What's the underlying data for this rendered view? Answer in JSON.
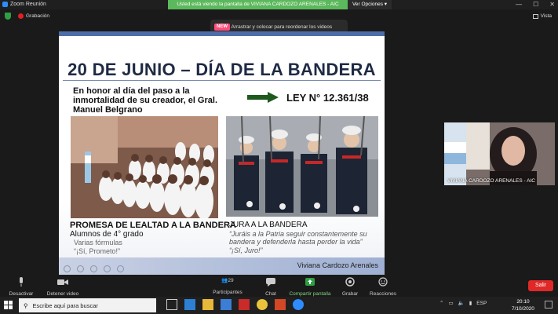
{
  "titlebar": {
    "app_title": "Zoom Reunión",
    "share_banner": "Usted está viendo la pantalla de VIVIANA CARDOZO ARENALES - AIC",
    "view_options": "Ver Opciones"
  },
  "recbar": {
    "recording_label": "Grabación",
    "view_label": "Vista"
  },
  "toast": {
    "badge": "NEW",
    "message": "Arrastrar y colocar para reordenar los videos"
  },
  "slide": {
    "title": "20 DE JUNIO – DÍA DE LA BANDERA",
    "description": "En honor al día del paso a la inmortalidad de su creador, el Gral. Manuel Belgrano",
    "law": "LEY N° 12.361/38",
    "left_caption_title": "PROMESA DE LEALTAD A LA BANDERA",
    "left_caption_sub": "Alumnos de 4° grado",
    "left_caption_note": "Varias fórmulas",
    "left_caption_quote": "“¡Sí, Prometo!”",
    "right_caption_title": "JURA A LA BANDERA",
    "right_caption_quote": "“Juráis a la Patria seguir constantemente su bandera y defenderla hasta perder la vida”",
    "right_caption_answer": "“¡Sí, Juro!”",
    "author": "Viviana Cardozo Arenales"
  },
  "participant": {
    "name": "VIVIANA CARDOZO ARENALES - AIC"
  },
  "toolbar": {
    "mute": "Desactivar audio",
    "stop_video": "Detener video",
    "participants": "Participantes",
    "participants_count": "29",
    "chat": "Chat",
    "share_screen": "Compartir pantalla",
    "record": "Grabar",
    "reactions": "Reacciones",
    "leave": "Salir"
  },
  "taskbar": {
    "search_placeholder": "Escribe aquí para buscar",
    "language": "ESP",
    "time": "20:10",
    "date": "7/10/2020"
  },
  "colors": {
    "share_green": "#5cb85c",
    "leave_red": "#e02828",
    "slide_title": "#1f2a44",
    "zoom_blue": "#2d8cff"
  }
}
